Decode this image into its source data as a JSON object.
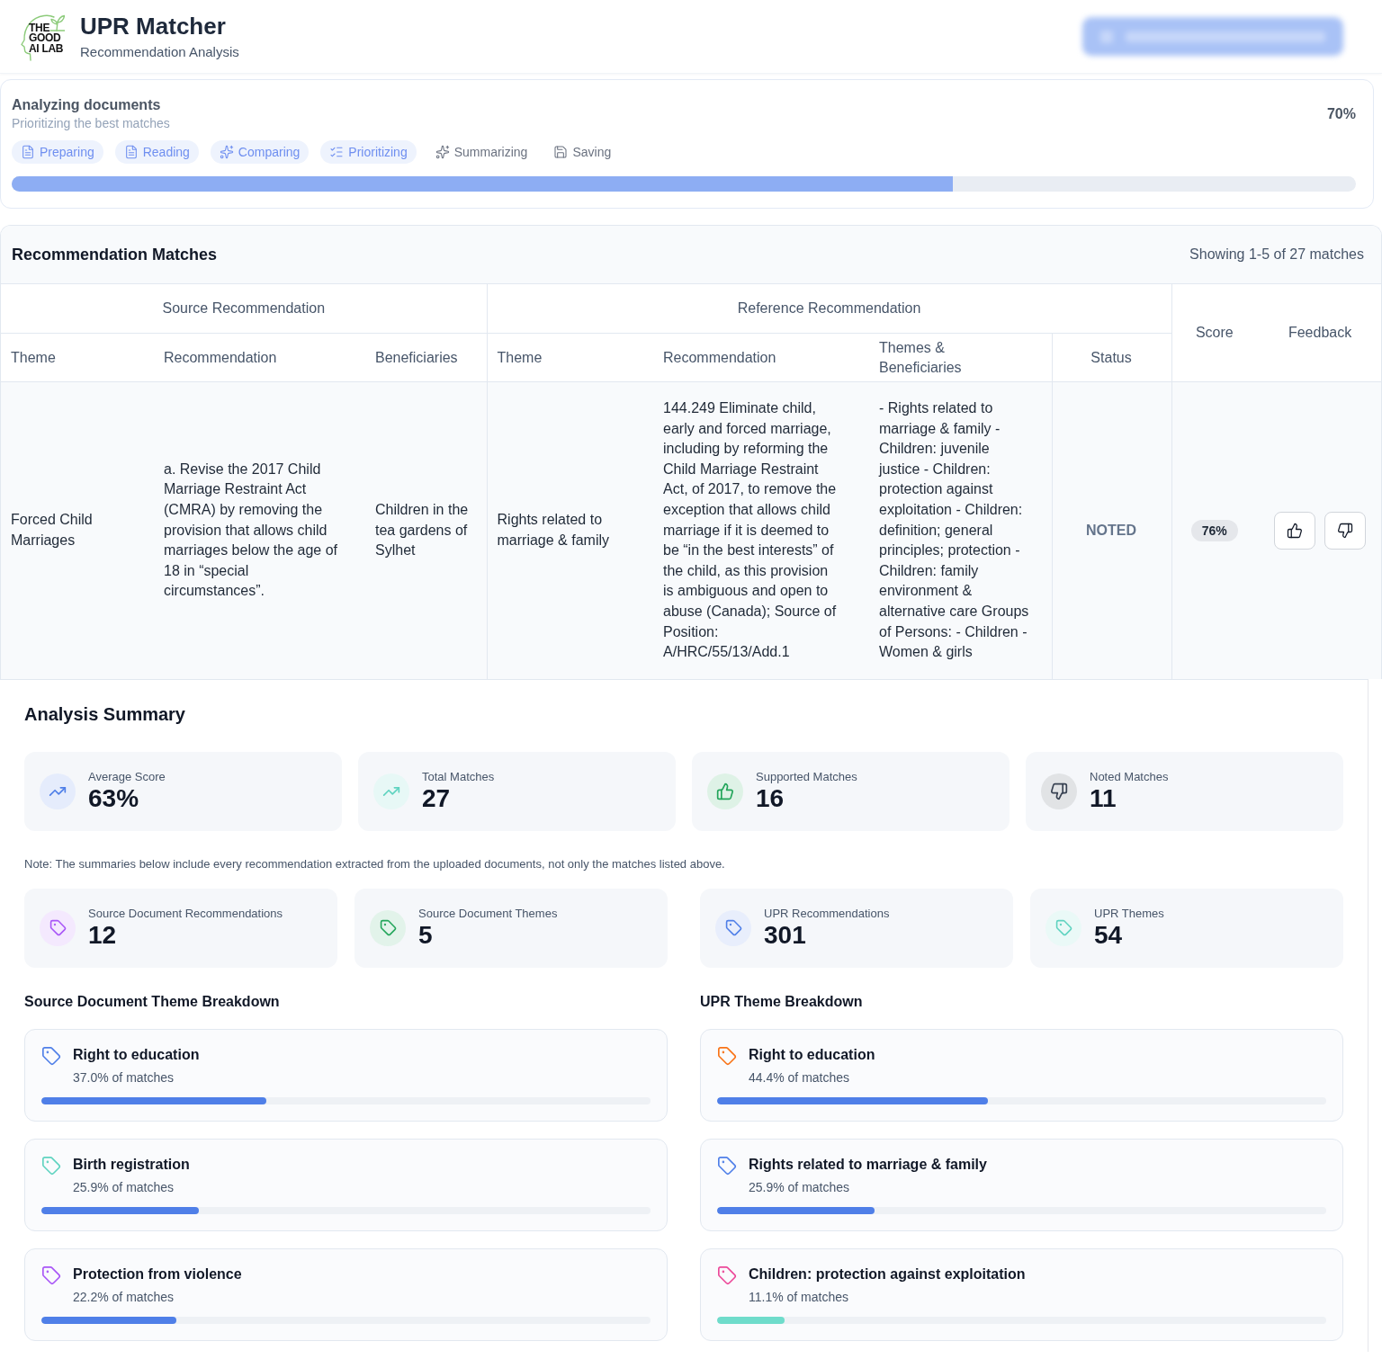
{
  "header": {
    "logo_lines": [
      "THE",
      "GOOD",
      "AI LAB"
    ],
    "title": "UPR Matcher",
    "subtitle": "Recommendation Analysis",
    "download_button": {
      "disabled": true
    }
  },
  "progress": {
    "title": "Analyzing documents",
    "subtitle": "Prioritizing the best matches",
    "percent": "70%",
    "level": 0.7,
    "steps": [
      {
        "label": "Preparing",
        "done": true
      },
      {
        "label": "Reading",
        "done": true
      },
      {
        "label": "Comparing",
        "done": true
      },
      {
        "label": "Prioritizing",
        "done": true
      },
      {
        "label": "Summarizing",
        "done": false
      },
      {
        "label": "Saving",
        "done": false
      }
    ]
  },
  "matches": {
    "title": "Recommendation Matches",
    "showing": "Showing 1-5 of 27 matches",
    "source_group": "Source Recommendation",
    "reference_group": "Reference Recommendation",
    "source_columns": [
      "Theme",
      "Recommendation",
      "Beneficiaries"
    ],
    "reference_columns": [
      "Theme",
      "Recommendation",
      "Themes & Beneficiaries",
      "Status"
    ],
    "score_column": "Score",
    "feedback_column": "Feedback",
    "rows": [
      {
        "source_theme": "Forced Child Marriages",
        "source_recommendation": "a. Revise the 2017 Child Marriage Restraint Act (CMRA) by removing the provision that allows child marriages below the age of 18 in “special circumstances”.",
        "beneficiaries": "Children in the tea gardens of Sylhet",
        "reference_theme": "Rights related to marriage & family",
        "reference_recommendation": "144.249 Eliminate child, early and forced marriage, including by reforming the Child Marriage Restraint Act, of 2017, to remove the exception that allows child marriage if it is deemed to be “in the best interests” of the child, as this provision is ambiguous and open to abuse (Canada); Source of Position: A/HRC/55/13/Add.1",
        "themes_beneficiaries": "- Rights related to marriage & family - Children: juvenile justice - Children: protection against exploitation - Children: definition; general principles; protection - Children: family environment & alternative care Groups of Persons: - Children - Women & girls",
        "status": "NOTED",
        "score": "76%"
      }
    ]
  },
  "summary": {
    "title": "Analysis Summary",
    "stats": [
      {
        "label": "Average Score",
        "value": "63%",
        "color": "#4f7fe8"
      },
      {
        "label": "Total Matches",
        "value": "27",
        "color": "#5fd3c0"
      },
      {
        "label": "Supported Matches",
        "value": "16",
        "color": "#22a55a"
      },
      {
        "label": "Noted Matches",
        "value": "11",
        "color": "#374151"
      }
    ],
    "note": "Note: The summaries below include every recommendation extracted from the uploaded documents, not only the matches listed above.",
    "panels": [
      {
        "cards": [
          {
            "label": "Source Document Recommendations",
            "value": "12",
            "color": "#a855f7"
          },
          {
            "label": "Source Document Themes",
            "value": "5",
            "color": "#22a55a"
          }
        ],
        "heading": "Source Document Theme Breakdown",
        "themes": [
          {
            "name": "Right to education",
            "share": "37.0% of matches",
            "level": 0.37,
            "color": "#4f7fe8"
          },
          {
            "name": "Birth registration",
            "share": "25.9% of matches",
            "level": 0.259,
            "color": "#5fd3c0"
          },
          {
            "name": "Protection from violence",
            "share": "22.2% of matches",
            "level": 0.222,
            "color": "#a855f7"
          }
        ]
      },
      {
        "cards": [
          {
            "label": "UPR Recommendations",
            "value": "301",
            "color": "#4f7fe8"
          },
          {
            "label": "UPR Themes",
            "value": "54",
            "color": "#5fd3c0"
          }
        ],
        "heading": "UPR Theme Breakdown",
        "themes": [
          {
            "name": "Right to education",
            "share": "44.4% of matches",
            "level": 0.444,
            "color": "#f97316"
          },
          {
            "name": "Rights related to marriage & family",
            "share": "25.9% of matches",
            "level": 0.259,
            "color": "#4f7fe8"
          },
          {
            "name": "Children: protection against exploitation",
            "share": "11.1% of matches",
            "level": 0.111,
            "color": "#ec4899"
          }
        ]
      }
    ]
  }
}
